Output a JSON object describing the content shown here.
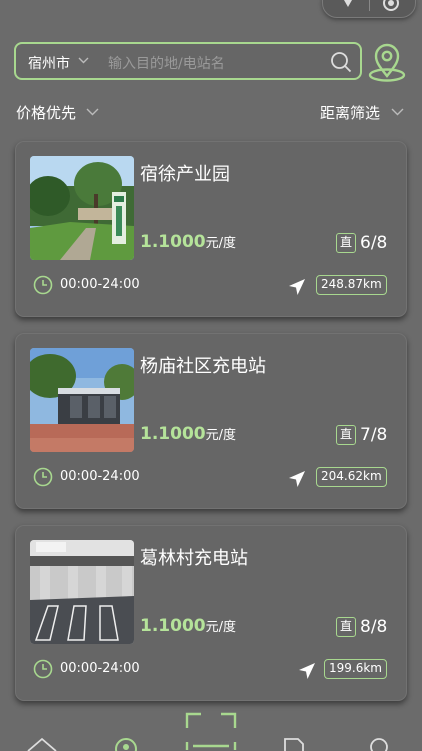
{
  "header": {
    "city": "宿州市",
    "search_placeholder": "输入目的地/电站名"
  },
  "filters": {
    "sort_label": "价格优先",
    "distance_label": "距离筛选"
  },
  "theme": {
    "accent": "#a8d88f",
    "price_color": "#b5e39a",
    "background": "#6b6b6b",
    "card": "#666666"
  },
  "stations": [
    {
      "name": "宿徐产业园",
      "price": "1.1000",
      "unit": "元/度",
      "pile_type": "直",
      "availability": "6/8",
      "hours": "00:00-24:00",
      "distance": "248.87km"
    },
    {
      "name": "杨庙社区充电站",
      "price": "1.1000",
      "unit": "元/度",
      "pile_type": "直",
      "availability": "7/8",
      "hours": "00:00-24:00",
      "distance": "204.62km"
    },
    {
      "name": "葛林村充电站",
      "price": "1.1000",
      "unit": "元/度",
      "pile_type": "直",
      "availability": "8/8",
      "hours": "00:00-24:00",
      "distance": "199.6km"
    }
  ],
  "icons": {
    "top_left": "pin-icon",
    "top_right": "target-icon",
    "search": "search-icon",
    "locate": "location-pin-icon",
    "clock": "clock-icon",
    "navigate": "navigation-arrow-icon",
    "tabs": [
      "home-icon",
      "map-icon",
      "scan-icon",
      "order-icon",
      "profile-icon"
    ]
  }
}
